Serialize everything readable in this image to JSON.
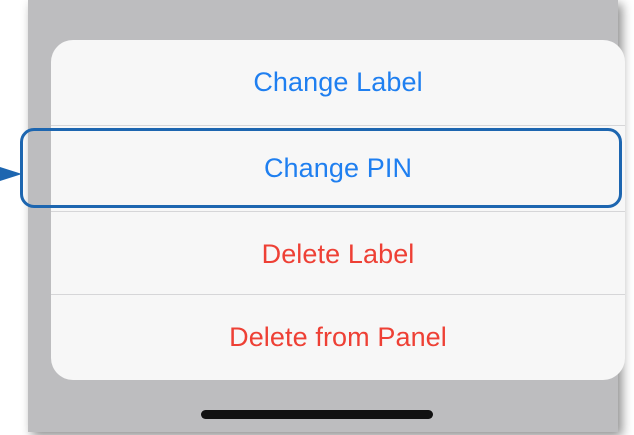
{
  "action_sheet": {
    "items": [
      {
        "label": "Change Label",
        "style": "default"
      },
      {
        "label": "Change PIN",
        "style": "default"
      },
      {
        "label": "Delete Label",
        "style": "destructive"
      },
      {
        "label": "Delete from Panel",
        "style": "destructive"
      }
    ]
  },
  "annotation": {
    "highlighted_item": "Change PIN",
    "color": "#1d66b0"
  },
  "colors": {
    "default_action": "#1f7ff0",
    "destructive_action": "#ee4035",
    "sheet_background": "#f7f7f7",
    "screen_background": "#bdbdbf"
  },
  "icons": {
    "pointer": "arrow-right-icon"
  }
}
